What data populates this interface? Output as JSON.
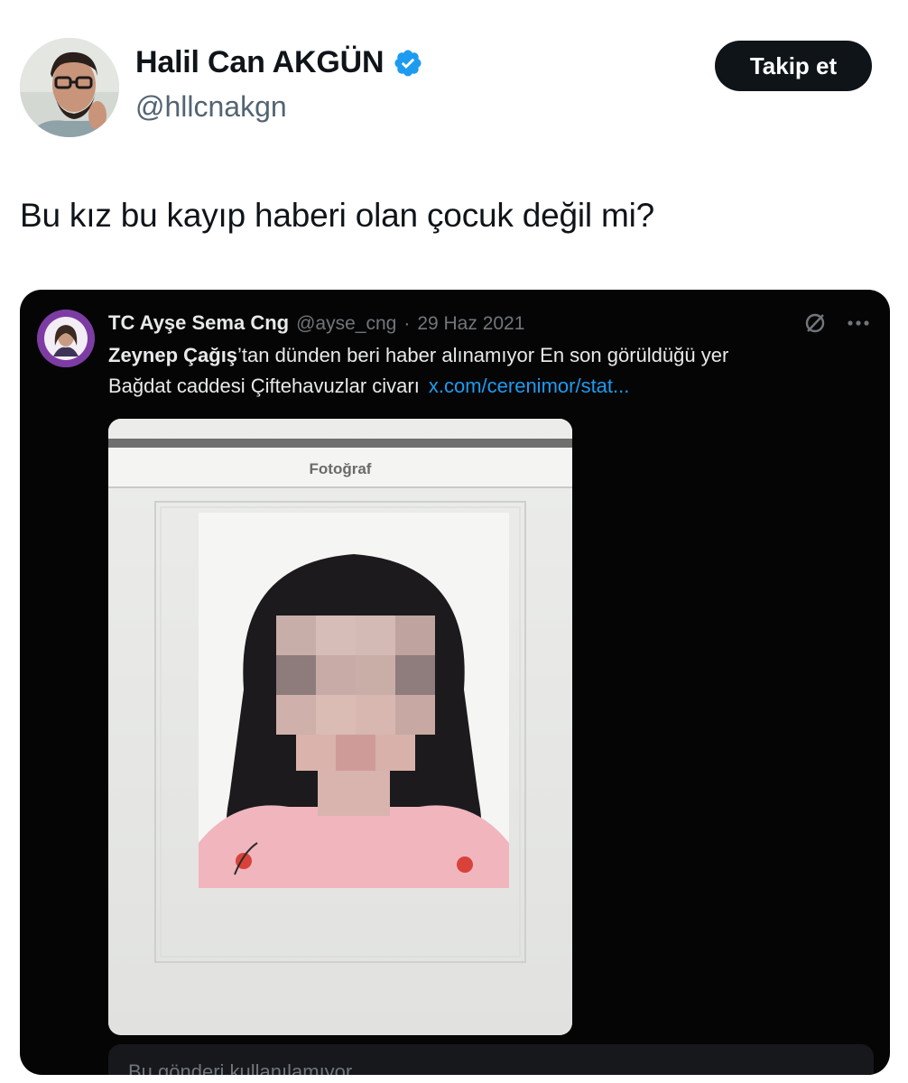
{
  "author": {
    "display_name": "Halil Can AKGÜN",
    "handle": "@hllcnakgn",
    "verified": true,
    "avatar_icon": "profile-photo"
  },
  "follow_button": {
    "label": "Takip et"
  },
  "tweet": {
    "text": "Bu kız bu kayıp haberi olan çocuk değil mi?"
  },
  "quoted_tweet": {
    "display_name": "TC Ayşe Sema Cng",
    "handle": "@ayse_cng",
    "separator": "·",
    "date": "29 Haz 2021",
    "text_bold": "Zeynep Çağış",
    "text_line1_rest": "’tan dünden beri haber alınamıyor En son görüldüğü yer",
    "text_line2": "Bağdat caddesi Çiftehavuzlar civarı",
    "link": "x.com/cerenimor/stat...",
    "media": {
      "form_label": "Fotoğraf",
      "face_blurred": true
    },
    "reply_placeholder": "Bu gönderi kullanılamıyor"
  },
  "colors": {
    "verified_blue": "#1d9bf0",
    "link_blue": "#1d9bf0",
    "button_bg": "#0f1419",
    "quote_bg": "#050505"
  }
}
